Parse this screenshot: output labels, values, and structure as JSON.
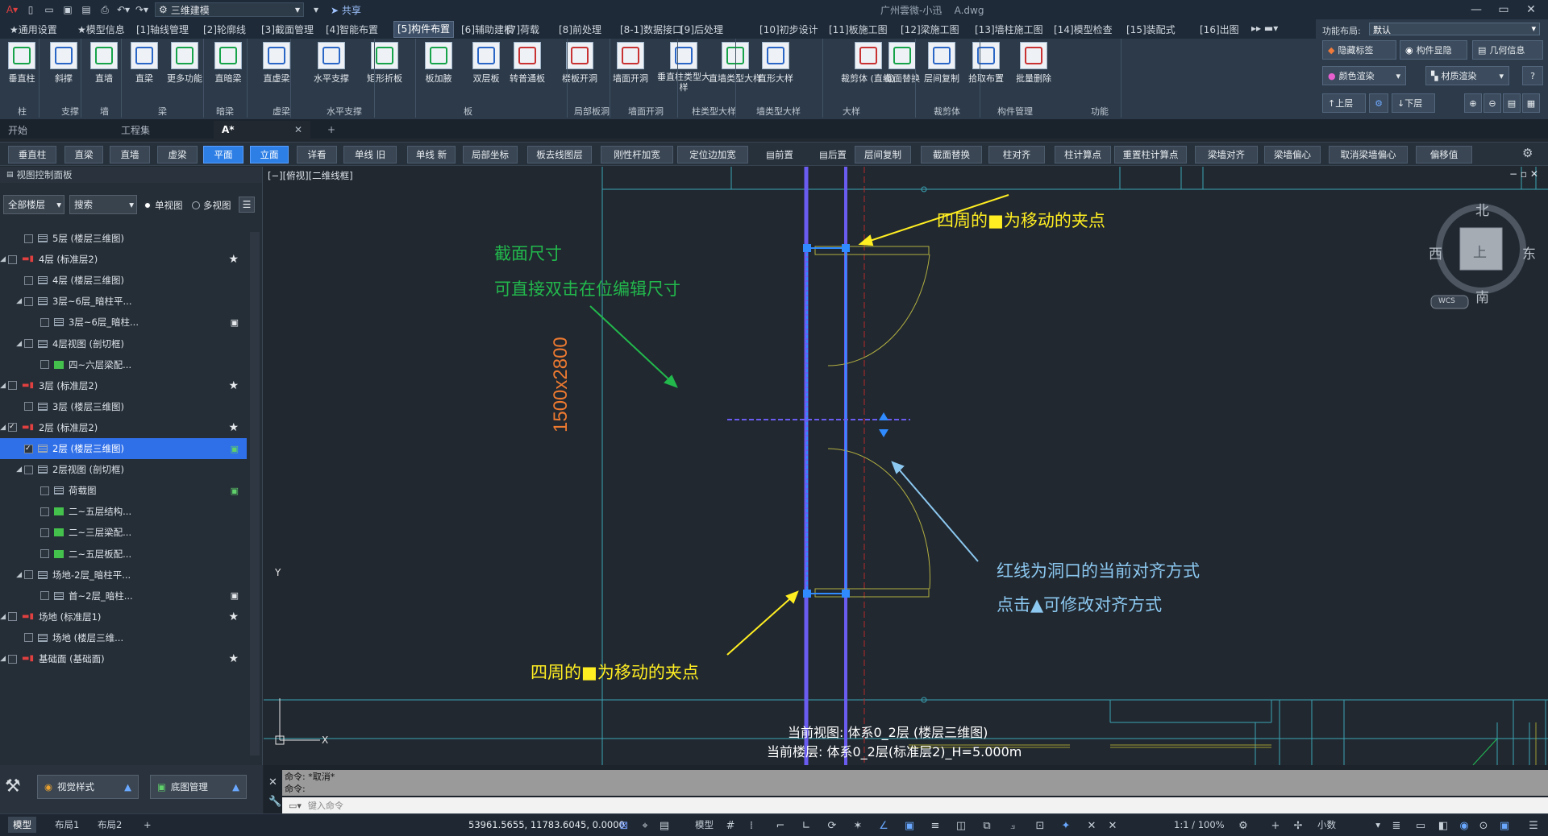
{
  "titlebar": {
    "workspace": "三维建模",
    "share": "共享",
    "user": "广州雲微-小迅",
    "filename": "A.dwg"
  },
  "menu_tabs": [
    "★通用设置",
    "★模型信息",
    "[1]轴线管理",
    "[2]轮廓线",
    "[3]截面管理",
    "[4]智能布置",
    "[5]构件布置",
    "[6]辅助建模",
    "[7]荷载",
    "[8]前处理",
    "[8-1]数据接口",
    "[9]后处理",
    "[10]初步设计",
    "[11]板施工图",
    "[12]梁施工图",
    "[13]墙柱施工图",
    "[14]模型检查",
    "[15]装配式",
    "[16]出图"
  ],
  "active_menu_tab": "[5]构件布置",
  "ribbon": {
    "tools": [
      "垂直柱",
      "斜撑",
      "直墙",
      "直梁",
      "更多功能",
      "直暗梁",
      "直虚梁",
      "水平支撑",
      "矩形折板",
      "板加腋",
      "双层板",
      "转普通板",
      "楼板开洞",
      "墙面开洞",
      "垂直柱类型大样",
      "直墙类型大样",
      "直形大样",
      "裁剪体 (直线)",
      "截面替换",
      "层间复制",
      "拾取布置",
      "批量删除"
    ],
    "groups": [
      "柱",
      "支撑",
      "墙",
      "梁",
      "暗梁",
      "虚梁",
      "水平支撑",
      "板",
      "局部板洞",
      "墙面开洞",
      "柱类型大样",
      "墙类型大样",
      "大样",
      "裁剪体",
      "构件管理",
      "功能"
    ]
  },
  "right_ribbon": {
    "layout_label": "功能布局:",
    "layout_value": "默认",
    "hide_tags": "隐藏标签",
    "member_display": "构件显隐",
    "geo_info": "几何信息",
    "color_render": "颜色渲染",
    "material_render": "材质渲染",
    "up_floor": "上层",
    "down_floor": "下层"
  },
  "doc_tabs": [
    "开始",
    "工程集",
    "A*"
  ],
  "command_buttons": [
    "垂直柱",
    "直梁",
    "直墙",
    "虚梁",
    "平面",
    "立面",
    "详看",
    "单线 旧",
    "单线 新",
    "局部坐标",
    "板去线图层",
    "刚性杆加宽",
    "定位边加宽",
    "前置",
    "后置",
    "层间复制",
    "截面替换",
    "柱对齐",
    "柱计算点",
    "重置柱计算点",
    "梁墙对齐",
    "梁墙偏心",
    "取消梁墙偏心",
    "偏移值"
  ],
  "panel": {
    "title": "视图控制面板",
    "floor_filter": "全部楼层",
    "search": "搜索",
    "single_view": "单视图",
    "multi_view": "多视图"
  },
  "tree": [
    {
      "label": "5层 (楼层三维图)"
    },
    {
      "label": "4层 (标准层2)"
    },
    {
      "label": "4层 (楼层三维图)"
    },
    {
      "label": "3层~6层_暗柱平..."
    },
    {
      "label": "3层~6层_暗柱..."
    },
    {
      "label": "4层视图 (剖切框)"
    },
    {
      "label": "四~六层梁配..."
    },
    {
      "label": "3层 (标准层2)"
    },
    {
      "label": "3层 (楼层三维图)"
    },
    {
      "label": "2层 (标准层2)"
    },
    {
      "label": "2层 (楼层三维图)"
    },
    {
      "label": "2层视图 (剖切框)"
    },
    {
      "label": "荷载图"
    },
    {
      "label": "二~五层结构..."
    },
    {
      "label": "二~三层梁配..."
    },
    {
      "label": "二~五层板配..."
    },
    {
      "label": "场地-2层_暗柱平..."
    },
    {
      "label": "首~2层_暗柱..."
    },
    {
      "label": "场地 (标准层1)"
    },
    {
      "label": "场地 (楼层三维..."
    },
    {
      "label": "基础面 (基础面)"
    }
  ],
  "left_bottom": {
    "visual_style": "视觉样式",
    "base_map": "底图管理"
  },
  "viewport": {
    "view_label": "[−][俯视][二维线框]",
    "dimension": "1500x2800",
    "annot_section_1": "截面尺寸",
    "annot_section_2": "可直接双击在位编辑尺寸",
    "annot_grip_top": "四周的■为移动的夹点",
    "annot_grip_bottom": "四周的■为移动的夹点",
    "annot_redline_1": "红线为洞口的当前对齐方式",
    "annot_redline_2": "点击▲可修改对齐方式",
    "status_view": "当前视图: 体系0_2层 (楼层三维图)",
    "status_floor": "当前楼层: 体系0_2层(标准层2)_H=5.000m",
    "compass": {
      "north": "北",
      "south": "南",
      "east": "东",
      "west": "西",
      "center": "上",
      "wcs": "WCS"
    }
  },
  "command": {
    "history_1": "命令: *取消*",
    "history_2": "命令:",
    "placeholder": "键入命令"
  },
  "statusbar": {
    "tabs": [
      "模型",
      "布局1",
      "布局2"
    ],
    "coords": "53961.5655, 11783.6045, 0.0000",
    "model_label": "模型",
    "scale": "1:1 / 100%",
    "units": "小数"
  },
  "colors": {
    "accent": "#2d7fe6",
    "annot_yellow": "#ffee22",
    "annot_green": "#22b84c",
    "annot_blue": "#8cc8f0",
    "wall_purple": "#6a5cf0"
  }
}
